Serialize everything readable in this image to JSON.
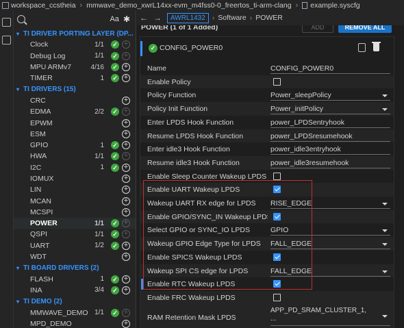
{
  "breadcrumb": {
    "items": [
      "workspace_ccstheia",
      "mmwave_demo_xwrL14xx-evm_m4fss0-0_freertos_ti-arm-clang",
      "example.syscfg"
    ]
  },
  "tree": {
    "toolbar": {
      "case_label": "Aa",
      "action_glyph": "✱"
    },
    "groups": [
      {
        "label": "TI DRIVER PORTING LAYER (DP...",
        "items": [
          {
            "name": "Clock",
            "count": "1/1",
            "ok": true,
            "add_enabled": false
          },
          {
            "name": "Debug Log",
            "count": "1/1",
            "ok": true,
            "add_enabled": false
          },
          {
            "name": "MPU ARMv7",
            "count": "4/16",
            "ok": true,
            "add_enabled": true
          },
          {
            "name": "TIMER",
            "count": "1",
            "ok": true,
            "add_enabled": true
          }
        ]
      },
      {
        "label": "TI DRIVERS (15)",
        "items": [
          {
            "name": "CRC",
            "count": "",
            "ok": false,
            "add_enabled": true
          },
          {
            "name": "EDMA",
            "count": "2/2",
            "ok": true,
            "add_enabled": false
          },
          {
            "name": "EPWM",
            "count": "",
            "ok": false,
            "add_enabled": true
          },
          {
            "name": "ESM",
            "count": "",
            "ok": false,
            "add_enabled": true
          },
          {
            "name": "GPIO",
            "count": "1",
            "ok": true,
            "add_enabled": true
          },
          {
            "name": "HWA",
            "count": "1/1",
            "ok": true,
            "add_enabled": false
          },
          {
            "name": "I2C",
            "count": "1",
            "ok": true,
            "add_enabled": true
          },
          {
            "name": "IOMUX",
            "count": "",
            "ok": false,
            "add_enabled": true
          },
          {
            "name": "LIN",
            "count": "",
            "ok": false,
            "add_enabled": true
          },
          {
            "name": "MCAN",
            "count": "",
            "ok": false,
            "add_enabled": true
          },
          {
            "name": "MCSPI",
            "count": "",
            "ok": false,
            "add_enabled": true
          },
          {
            "name": "POWER",
            "count": "1/1",
            "ok": true,
            "add_enabled": false,
            "selected": true
          },
          {
            "name": "QSPI",
            "count": "1/1",
            "ok": true,
            "add_enabled": false
          },
          {
            "name": "UART",
            "count": "1/2",
            "ok": true,
            "add_enabled": true
          },
          {
            "name": "WDT",
            "count": "",
            "ok": false,
            "add_enabled": true
          }
        ]
      },
      {
        "label": "TI BOARD DRIVERS (2)",
        "items": [
          {
            "name": "FLASH",
            "count": "1",
            "ok": true,
            "add_enabled": true
          },
          {
            "name": "INA",
            "count": "3/4",
            "ok": true,
            "add_enabled": true
          }
        ]
      },
      {
        "label": "TI DEMO (2)",
        "items": [
          {
            "name": "MMWAVE_DEMO",
            "count": "1/1",
            "ok": true,
            "add_enabled": false
          },
          {
            "name": "MPD_DEMO",
            "count": "",
            "ok": false,
            "add_enabled": true
          }
        ]
      }
    ]
  },
  "header": {
    "device": "AWRL1432",
    "section": "Software",
    "module": "POWER"
  },
  "panel": {
    "title": "POWER (1 of 1 Added)",
    "add_button": "ADD",
    "remove_button": "REMOVE ALL",
    "instance_name": "CONFIG_POWER0",
    "rows": [
      {
        "label": "Name",
        "type": "text",
        "value": "CONFIG_POWER0"
      },
      {
        "label": "Enable Policy",
        "type": "checkbox",
        "checked": false
      },
      {
        "label": "Policy Function",
        "type": "select",
        "value": "Power_sleepPolicy"
      },
      {
        "label": "Policy Init Function",
        "type": "select",
        "value": "Power_initPolicy"
      },
      {
        "label": "Enter LPDS Hook Function",
        "type": "text",
        "value": "power_LPDSentryhook"
      },
      {
        "label": "Resume LPDS Hook Function",
        "type": "text",
        "value": "power_LPDSresumehook"
      },
      {
        "label": "Enter idle3 Hook Function",
        "type": "text",
        "value": "power_idle3entryhook"
      },
      {
        "label": "Resume idle3 Hook Function",
        "type": "text",
        "value": "power_idle3resumehook"
      },
      {
        "label": "Enable Sleep Counter Wakeup LPDS ...",
        "type": "checkbox",
        "checked": false
      },
      {
        "label": "Enable UART Wakeup LPDS",
        "type": "checkbox",
        "checked": true
      },
      {
        "label": "Wakeup UART RX edge for LPDS",
        "type": "select",
        "value": "RISE_EDGE"
      },
      {
        "label": "Enable GPIO/SYNC_IN Wakeup LPDS...",
        "type": "checkbox",
        "checked": true
      },
      {
        "label": "Select GPIO or SYNC_IO LPDS",
        "type": "select",
        "value": "GPIO"
      },
      {
        "label": "Wakeup GPIO Edge Type for LPDS",
        "type": "select",
        "value": "FALL_EDGE"
      },
      {
        "label": "Enable SPICS Wakeup LPDS",
        "type": "checkbox",
        "checked": true
      },
      {
        "label": "Wakeup SPI CS edge for LPDS",
        "type": "select",
        "value": "FALL_EDGE"
      },
      {
        "label": "Enable RTC Wakeup LPDS",
        "type": "checkbox",
        "checked": true,
        "marked": true
      },
      {
        "label": "Enable FRC Wakeup LPDS",
        "type": "checkbox",
        "checked": false
      }
    ],
    "ram_retention": {
      "label": "RAM Retention Mask LPDS",
      "value_line1": "APP_PD_SRAM_CLUSTER_1,",
      "value_line2": "..."
    }
  }
}
